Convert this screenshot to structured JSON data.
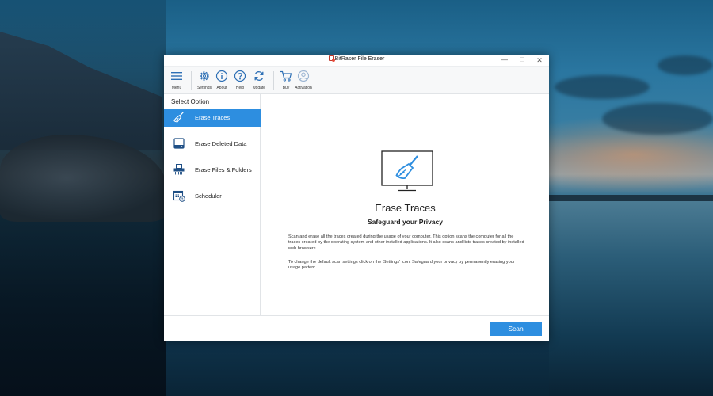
{
  "window": {
    "title": "BitRaser File Eraser",
    "controls": {
      "minimize": "—",
      "maximize": "☐",
      "close": "✕"
    }
  },
  "toolbar": {
    "items": [
      {
        "label": "Menu",
        "icon": "hamburger-menu-icon"
      },
      {
        "label": "Settings",
        "icon": "gear-icon"
      },
      {
        "label": "About",
        "icon": "info-icon"
      },
      {
        "label": "Help",
        "icon": "question-icon"
      },
      {
        "label": "Update",
        "icon": "refresh-icon"
      },
      {
        "label": "Buy",
        "icon": "cart-icon"
      },
      {
        "label": "Activation",
        "icon": "user-icon"
      }
    ]
  },
  "sidebar": {
    "title": "Select Option",
    "items": [
      {
        "label": "Erase Traces",
        "icon": "broom-icon",
        "active": true
      },
      {
        "label": "Erase Deleted Data",
        "icon": "hard-drive-icon",
        "active": false
      },
      {
        "label": "Erase Files & Folders",
        "icon": "shredder-icon",
        "active": false
      },
      {
        "label": "Scheduler",
        "icon": "calendar-clock-icon",
        "active": false
      }
    ]
  },
  "main": {
    "title": "Erase Traces",
    "subtitle": "Safeguard your Privacy",
    "paragraph1": "Scan and erase all the traces created during the usage of your computer. This option scans the computer for all the traces created by the operating system and other installed applications. It also scans and lists traces created by installed web browsers.",
    "paragraph2": "To change the default scan settings click on the 'Settings' icon. Safeguard your privacy by permanently erasing your usage pattern."
  },
  "footer": {
    "scan_label": "Scan"
  },
  "colors": {
    "accent": "#2d8ee0",
    "toolbar_icon": "#2d6fb5",
    "text": "#222222"
  }
}
